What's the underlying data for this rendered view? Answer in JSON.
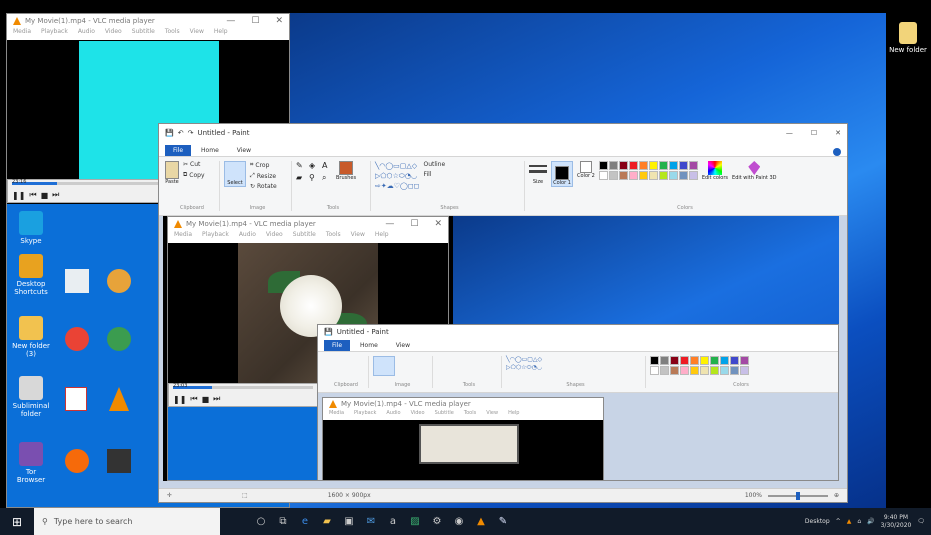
{
  "taskbar": {
    "search_placeholder": "Type here to search",
    "time": "9:40 PM",
    "date": "3/30/2020",
    "desktop_label": "Desktop"
  },
  "desktop": {
    "new_folder": "New folder",
    "icons": [
      {
        "label": "Skype",
        "color": "#1aa0e0"
      },
      {
        "label": "Desktop Shortcuts",
        "color": "#e8a21f"
      },
      {
        "label": "New folder (3)",
        "color": "#f2c24f"
      },
      {
        "label": "Subliminal folder",
        "color": "#d8d8d8"
      },
      {
        "label": "Tor Browser",
        "color": "#7a4fb0"
      }
    ]
  },
  "vlc_outer": {
    "title": "My Movie(1).mp4 - VLC media player",
    "menu": [
      "Media",
      "Playback",
      "Audio",
      "Video",
      "Subtitle",
      "Tools",
      "View",
      "Help"
    ],
    "time": "23:16"
  },
  "paint_outer": {
    "title": "Untitled - Paint",
    "tabs": [
      "File",
      "Home",
      "View"
    ],
    "groups": [
      "Clipboard",
      "Image",
      "Tools",
      "Shapes",
      "Colors"
    ],
    "clipboard": {
      "paste": "Paste",
      "cut": "Cut",
      "copy": "Copy"
    },
    "image": {
      "select": "Select",
      "crop": "Crop",
      "resize": "Resize",
      "rotate": "Rotate"
    },
    "tools": {
      "brushes": "Brushes"
    },
    "shapes": {
      "outline": "Outline",
      "fill": "Fill"
    },
    "colors": {
      "size": "Size",
      "color1": "Color 1",
      "color2": "Color 2",
      "edit": "Edit colors",
      "edit3d": "Edit with Paint 3D"
    },
    "status_size": "1600 × 900px",
    "zoom": "100%"
  },
  "vlc_inner": {
    "title": "My Movie(1).mp4 - VLC media player",
    "menu": [
      "Media",
      "Playback",
      "Audio",
      "Video",
      "Subtitle",
      "Tools",
      "View",
      "Help"
    ],
    "time": "23:03"
  },
  "paint_inner": {
    "title": "Untitled - Paint",
    "tabs": [
      "File",
      "Home",
      "View"
    ],
    "groups": [
      "Clipboard",
      "Image",
      "Tools",
      "Shapes",
      "Colors"
    ]
  },
  "vlc_small": {
    "title": "My Movie(1).mp4 - VLC media player",
    "menu": [
      "Media",
      "Playback",
      "Audio",
      "Video",
      "Subtitle",
      "Tools",
      "View",
      "Help"
    ]
  },
  "palette": [
    "#000000",
    "#7f7f7f",
    "#880015",
    "#ed1c24",
    "#ff7f27",
    "#fff200",
    "#22b14c",
    "#00a2e8",
    "#3f48cc",
    "#a349a4",
    "#ffffff",
    "#c3c3c3",
    "#b97a57",
    "#ffaec9",
    "#ffc90e",
    "#efe4b0",
    "#b5e61d",
    "#99d9ea",
    "#7092be",
    "#c8bfe7"
  ],
  "colors": {
    "accent": "#1d5fbf",
    "cyan": "#1ee3e8",
    "desktop_blue": "#1a6fe0"
  }
}
